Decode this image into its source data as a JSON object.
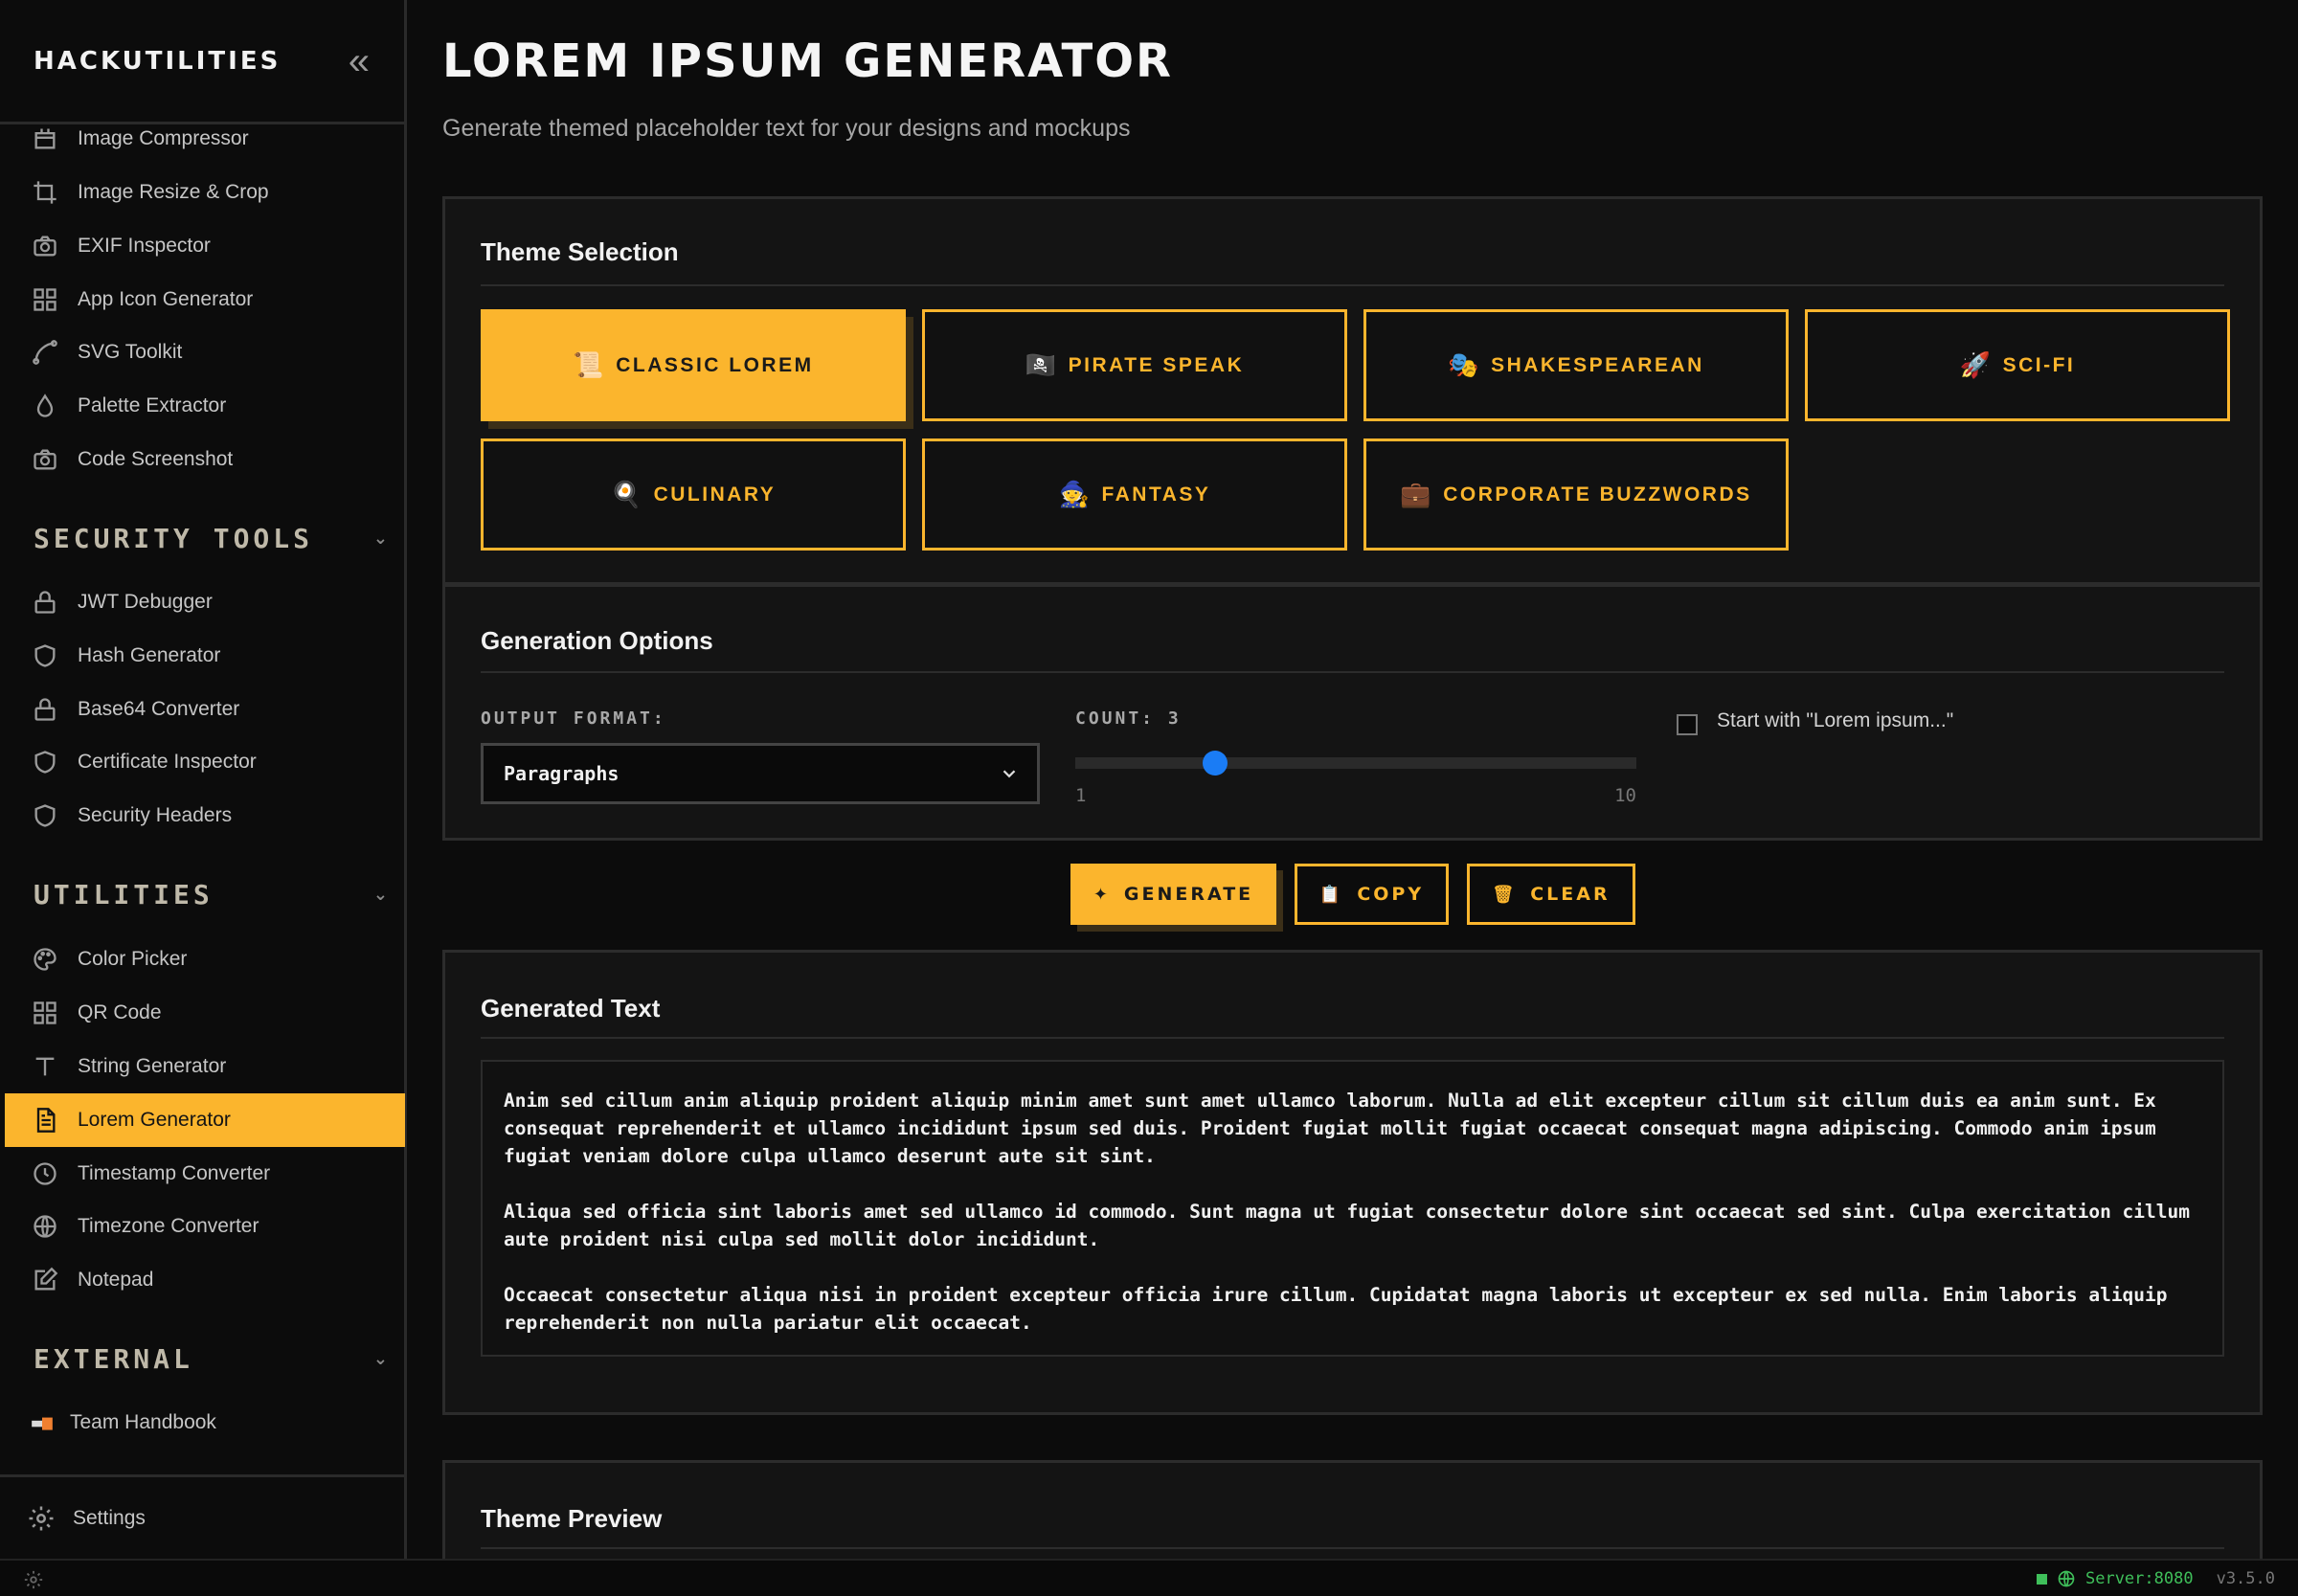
{
  "sidebar": {
    "brand": "HACKUTILITIES",
    "collapse_glyph": "«",
    "items_top": [
      {
        "label": "Image Compressor",
        "icon": "compress-icon"
      },
      {
        "label": "Image Resize & Crop",
        "icon": "crop-icon"
      },
      {
        "label": "EXIF Inspector",
        "icon": "camera-icon"
      },
      {
        "label": "App Icon Generator",
        "icon": "grid-icon"
      },
      {
        "label": "SVG Toolkit",
        "icon": "bezier-icon"
      },
      {
        "label": "Palette Extractor",
        "icon": "droplet-icon"
      },
      {
        "label": "Code Screenshot",
        "icon": "camera-icon"
      }
    ],
    "sections": [
      {
        "title": "SECURITY TOOLS",
        "items": [
          {
            "label": "JWT Debugger",
            "icon": "lock-icon"
          },
          {
            "label": "Hash Generator",
            "icon": "shield-icon"
          },
          {
            "label": "Base64 Converter",
            "icon": "lock-icon"
          },
          {
            "label": "Certificate Inspector",
            "icon": "shield-icon"
          },
          {
            "label": "Security Headers",
            "icon": "shield-icon"
          }
        ]
      },
      {
        "title": "UTILITIES",
        "items": [
          {
            "label": "Color Picker",
            "icon": "palette-icon"
          },
          {
            "label": "QR Code",
            "icon": "grid-icon"
          },
          {
            "label": "String Generator",
            "icon": "text-icon"
          },
          {
            "label": "Lorem Generator",
            "icon": "document-icon",
            "active": true
          },
          {
            "label": "Timestamp Converter",
            "icon": "clock-icon"
          },
          {
            "label": "Timezone Converter",
            "icon": "globe-icon"
          },
          {
            "label": "Notepad",
            "icon": "edit-icon"
          }
        ]
      },
      {
        "title": "EXTERNAL",
        "items": [
          {
            "label": "Team Handbook",
            "icon": "external-link-icon"
          }
        ]
      }
    ],
    "settings_label": "Settings"
  },
  "statusbar": {
    "server": "Server:8080",
    "version": "v3.5.0",
    "status_color": "#3fbf5a"
  },
  "page": {
    "title": "LOREM IPSUM GENERATOR",
    "subtitle": "Generate themed placeholder text for your designs and mockups"
  },
  "theme_selection": {
    "heading": "Theme Selection",
    "themes": [
      {
        "label": "CLASSIC LOREM",
        "emoji": "📜",
        "active": true
      },
      {
        "label": "PIRATE SPEAK",
        "emoji": "🏴‍☠️"
      },
      {
        "label": "SHAKESPEAREAN",
        "emoji": "🎭"
      },
      {
        "label": "SCI-FI",
        "emoji": "🚀"
      },
      {
        "label": "CULINARY",
        "emoji": "🍳"
      },
      {
        "label": "FANTASY",
        "emoji": "🧙"
      },
      {
        "label": "CORPORATE BUZZWORDS",
        "emoji": "💼"
      }
    ]
  },
  "generation_options": {
    "heading": "Generation Options",
    "format_label": "OUTPUT FORMAT:",
    "format_value": "Paragraphs",
    "count_label": "COUNT: 3",
    "count": 3,
    "count_min": 1,
    "count_max": 10,
    "count_min_label": "1",
    "count_max_label": "10",
    "start_with_label": "Start with \"Lorem ipsum...\"",
    "start_with_checked": false
  },
  "actions": {
    "generate": "GENERATE",
    "copy": "COPY",
    "clear": "CLEAR",
    "generate_icon": "✦",
    "copy_icon": "📋",
    "clear_icon": "🗑"
  },
  "output": {
    "heading": "Generated Text",
    "paragraphs": [
      "Anim sed cillum anim aliquip proident aliquip minim amet sunt amet ullamco laborum. Nulla ad elit excepteur cillum sit cillum duis ea anim sunt. Ex consequat reprehenderit et ullamco incididunt ipsum sed duis. Proident fugiat mollit fugiat occaecat consequat magna adipiscing. Commodo anim ipsum fugiat veniam dolore culpa ullamco deserunt aute sit sint.",
      "Aliqua sed officia sint laboris amet sed ullamco id commodo. Sunt magna ut fugiat consectetur dolore sint occaecat sed sint. Culpa exercitation cillum aute proident nisi culpa sed mollit dolor incididunt.",
      "Occaecat consectetur aliqua nisi in proident excepteur officia irure cillum. Cupidatat magna laboris ut excepteur ex sed nulla. Enim laboris aliquip reprehenderit non nulla pariatur elit occaecat."
    ]
  },
  "preview": {
    "heading": "Theme Preview"
  },
  "colors": {
    "accent": "#fbb52d",
    "slider": "#1a7cf5",
    "background": "#0c0c0c",
    "panel": "#141414"
  }
}
